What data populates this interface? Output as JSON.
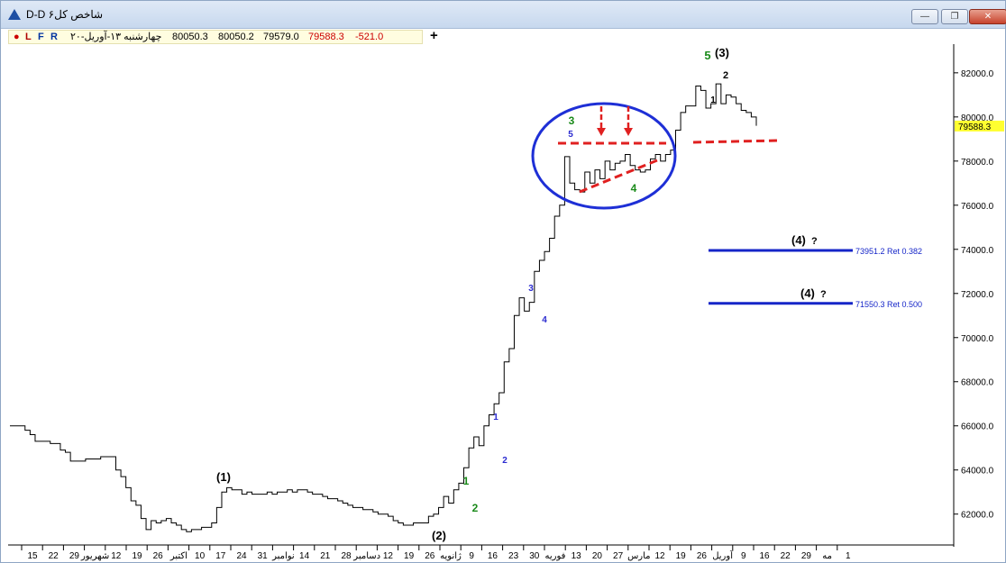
{
  "window": {
    "title": "D-D شاخص کل۶",
    "buttons": [
      "minimize",
      "restore",
      "close"
    ]
  },
  "infobar": {
    "dot_color": "#cc0000",
    "letters": [
      "L",
      "F",
      "R"
    ],
    "date": "چهارشنبه ۱۳-آوریل-۲۰",
    "open": "80050.3",
    "high": "80050.2",
    "low": "79579.0",
    "close": "79588.3",
    "change": "-521.0"
  },
  "toolbar_plus": "+",
  "chart_data": {
    "type": "line",
    "title": "",
    "xlabel": "",
    "ylabel": "",
    "ylim": [
      60600,
      83300
    ],
    "grid": false,
    "y_ticks": [
      62000,
      64000,
      66000,
      68000,
      70000,
      72000,
      74000,
      76000,
      78000,
      80000,
      82000
    ],
    "y_tick_labels": [
      "62000.0",
      "64000.0",
      "66000.0",
      "68000.0",
      "70000.0",
      "72000.0",
      "74000.0",
      "76000.0",
      "78000.0",
      "80000.0",
      "82000.0"
    ],
    "x_ticks": [
      "15",
      "22",
      "29",
      "شهریور",
      "12",
      "19",
      "26",
      "اکتبر",
      "10",
      "17",
      "24",
      "31",
      "نوامبر",
      "14",
      "21",
      "28",
      "دسامبر",
      "12",
      "19",
      "26",
      "ژانویه",
      "9",
      "16",
      "23",
      "30",
      "فوریه",
      "13",
      "20",
      "27",
      "مارس",
      "12",
      "19",
      "26",
      "آوریل",
      "9",
      "16",
      "22",
      "29",
      "مه",
      "1"
    ],
    "series": [
      {
        "values": [
          [
            0,
            66000
          ],
          [
            2,
            66000
          ],
          [
            3,
            65800
          ],
          [
            4,
            65600
          ],
          [
            5,
            65300
          ],
          [
            7,
            65300
          ],
          [
            8,
            65200
          ],
          [
            9,
            65200
          ],
          [
            10,
            64900
          ],
          [
            11,
            64800
          ],
          [
            12,
            64400
          ],
          [
            14,
            64400
          ],
          [
            15,
            64500
          ],
          [
            17,
            64500
          ],
          [
            18,
            64600
          ],
          [
            20,
            64600
          ],
          [
            21,
            64000
          ],
          [
            22,
            63700
          ],
          [
            23,
            63200
          ],
          [
            24,
            62600
          ],
          [
            25,
            62400
          ],
          [
            26,
            61800
          ],
          [
            27,
            61300
          ],
          [
            28,
            61700
          ],
          [
            29,
            61600
          ],
          [
            30,
            61700
          ],
          [
            31,
            61800
          ],
          [
            32,
            61600
          ],
          [
            33,
            61500
          ],
          [
            34,
            61300
          ],
          [
            35,
            61200
          ],
          [
            36,
            61300
          ],
          [
            37,
            61300
          ],
          [
            38,
            61400
          ],
          [
            39,
            61400
          ],
          [
            40,
            61600
          ],
          [
            41,
            62300
          ],
          [
            42,
            63000
          ],
          [
            43,
            63200
          ],
          [
            44,
            63100
          ],
          [
            45,
            63100
          ],
          [
            46,
            62900
          ],
          [
            47,
            63000
          ],
          [
            48,
            62900
          ],
          [
            49,
            62900
          ],
          [
            50,
            62900
          ],
          [
            51,
            63000
          ],
          [
            52,
            62900
          ],
          [
            53,
            63000
          ],
          [
            54,
            63000
          ],
          [
            55,
            63100
          ],
          [
            56,
            63000
          ],
          [
            57,
            63100
          ],
          [
            58,
            63100
          ],
          [
            59,
            63000
          ],
          [
            60,
            62900
          ],
          [
            61,
            62900
          ],
          [
            62,
            62800
          ],
          [
            63,
            62700
          ],
          [
            64,
            62700
          ],
          [
            65,
            62600
          ],
          [
            66,
            62500
          ],
          [
            67,
            62400
          ],
          [
            68,
            62300
          ],
          [
            69,
            62300
          ],
          [
            70,
            62200
          ],
          [
            71,
            62200
          ],
          [
            72,
            62100
          ],
          [
            73,
            62000
          ],
          [
            74,
            62000
          ],
          [
            75,
            61900
          ],
          [
            76,
            61700
          ],
          [
            77,
            61600
          ],
          [
            78,
            61500
          ],
          [
            79,
            61500
          ],
          [
            80,
            61600
          ],
          [
            81,
            61600
          ],
          [
            82,
            61600
          ],
          [
            83,
            61900
          ],
          [
            84,
            62000
          ],
          [
            85,
            62300
          ],
          [
            86,
            62800
          ],
          [
            87,
            62500
          ],
          [
            88,
            63100
          ],
          [
            89,
            63400
          ],
          [
            90,
            64100
          ],
          [
            91,
            65000
          ],
          [
            92,
            65500
          ],
          [
            93,
            65100
          ],
          [
            94,
            66000
          ],
          [
            95,
            66500
          ],
          [
            96,
            67000
          ],
          [
            97,
            67500
          ],
          [
            98,
            68900
          ],
          [
            99,
            69500
          ],
          [
            100,
            71000
          ],
          [
            101,
            71800
          ],
          [
            102,
            71200
          ],
          [
            103,
            71600
          ],
          [
            104,
            73000
          ],
          [
            105,
            73500
          ],
          [
            106,
            73900
          ],
          [
            107,
            74500
          ],
          [
            108,
            75500
          ],
          [
            109,
            76000
          ],
          [
            110,
            78200
          ],
          [
            111,
            77000
          ],
          [
            112,
            76700
          ],
          [
            113,
            76600
          ],
          [
            114,
            77500
          ],
          [
            115,
            77000
          ],
          [
            116,
            77600
          ],
          [
            117,
            77200
          ],
          [
            118,
            78000
          ],
          [
            119,
            77600
          ],
          [
            120,
            77900
          ],
          [
            121,
            78000
          ],
          [
            122,
            78300
          ],
          [
            123,
            77800
          ],
          [
            124,
            77600
          ],
          [
            125,
            77500
          ],
          [
            126,
            77600
          ],
          [
            127,
            78100
          ],
          [
            128,
            78300
          ],
          [
            129,
            78000
          ],
          [
            130,
            78300
          ],
          [
            131,
            78500
          ],
          [
            132,
            79400
          ],
          [
            133,
            80200
          ],
          [
            134,
            80500
          ],
          [
            135,
            80500
          ],
          [
            136,
            81400
          ],
          [
            137,
            81200
          ],
          [
            138,
            80400
          ],
          [
            139,
            80600
          ],
          [
            140,
            81500
          ],
          [
            141,
            80600
          ],
          [
            142,
            81000
          ],
          [
            143,
            80900
          ],
          [
            144,
            80600
          ],
          [
            145,
            80300
          ],
          [
            146,
            80200
          ],
          [
            147,
            80000
          ],
          [
            148,
            79600
          ]
        ]
      }
    ],
    "current_price": "79588.3",
    "retracement_lines": [
      {
        "value": 73951.2,
        "label": "73951.2 Ret 0.382",
        "wave_label": "(4)",
        "question": "?"
      },
      {
        "value": 71550.3,
        "label": "71550.3 Ret 0.500",
        "wave_label": "(4)",
        "question": "?"
      }
    ],
    "annotations": [
      {
        "text": "(1)",
        "color": "#000000"
      },
      {
        "text": "(2)",
        "color": "#000000"
      },
      {
        "text": "1",
        "color": "#1a8a1a"
      },
      {
        "text": "2",
        "color": "#1a8a1a"
      },
      {
        "text": "1",
        "color": "#2b2bd0"
      },
      {
        "text": "2",
        "color": "#2b2bd0"
      },
      {
        "text": "3",
        "color": "#2b2bd0"
      },
      {
        "text": "4",
        "color": "#2b2bd0"
      },
      {
        "text": "5",
        "color": "#2b2bd0"
      },
      {
        "text": "3",
        "color": "#1a8a1a"
      },
      {
        "text": "4",
        "color": "#1a8a1a"
      },
      {
        "text": "5",
        "color": "#1a8a1a"
      },
      {
        "text": "(3)",
        "color": "#000000"
      },
      {
        "text": "1",
        "color": "#000000"
      },
      {
        "text": "2",
        "color": "#000000"
      }
    ],
    "colors": {
      "price_line": "#000000",
      "trendline": "#e02020",
      "circle": "#1e2fd6",
      "retracement": "#1525c8",
      "current_price_bg": "#ffff30"
    }
  }
}
